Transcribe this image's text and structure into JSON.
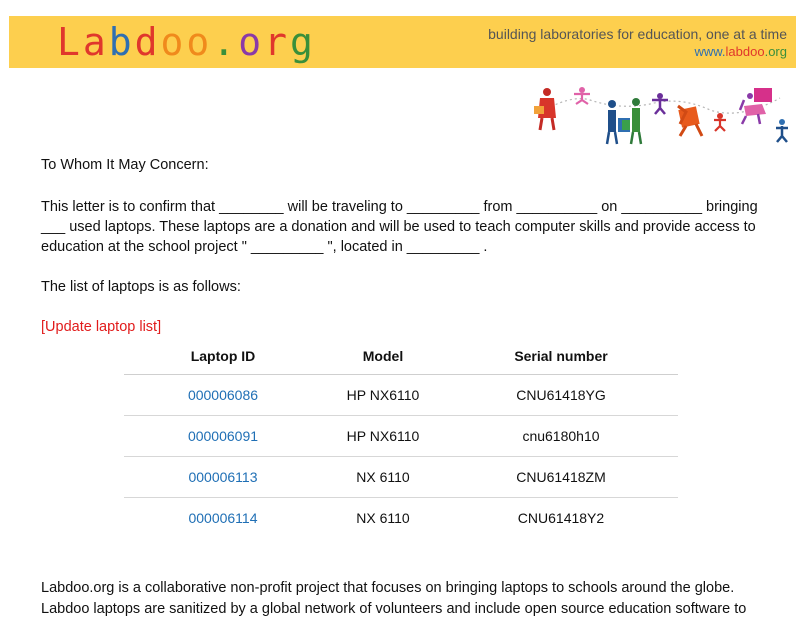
{
  "header": {
    "logo_segments": [
      {
        "text": "La",
        "color": "#e0372c"
      },
      {
        "text": "b",
        "color": "#2f6fb1"
      },
      {
        "text": "d",
        "color": "#e0372c"
      },
      {
        "text": "oo",
        "color": "#f08a1c"
      },
      {
        "text": ".",
        "color": "#3a8f3a"
      },
      {
        "text": "o",
        "color": "#8a3aa8"
      },
      {
        "text": "r",
        "color": "#e0372c"
      },
      {
        "text": "g",
        "color": "#3a8f3a"
      }
    ],
    "tagline": "building laboratories for education, one at a time",
    "url_www": "www.",
    "url_name": "labdoo",
    "url_tld": ".org",
    "banner_color": "#fdcf4e"
  },
  "letter": {
    "greeting": "To Whom It May Concern:",
    "body": "This letter is to confirm that ________ will be traveling to _________ from __________ on __________ bringing ___ used laptops.  These laptops are a donation and will be used to teach computer skills and provide access to education at the school project \" _________ \", located in  _________ .",
    "list_intro": "The list of laptops is as follows:",
    "update_link": "[Update laptop list]"
  },
  "table": {
    "headers": [
      "Laptop ID",
      "Model",
      "Serial number"
    ],
    "rows": [
      {
        "id": "000006086",
        "model": "HP NX6110",
        "serial": "CNU61418YG"
      },
      {
        "id": "000006091",
        "model": "HP NX6110",
        "serial": "cnu6180h10"
      },
      {
        "id": "000006113",
        "model": "NX 6110",
        "serial": "CNU61418ZM"
      },
      {
        "id": "000006114",
        "model": "NX 6110",
        "serial": "CNU61418Y2"
      }
    ]
  },
  "footer": {
    "text": "Labdoo.org is a collaborative non-profit project that focuses on bringing laptops to schools around the globe. Labdoo laptops are sanitized by a global network of volunteers and include open source education software to"
  },
  "colors": {
    "link": "#1f6fb5",
    "update_link": "#e11b1b",
    "banner": "#fdcf4e"
  }
}
